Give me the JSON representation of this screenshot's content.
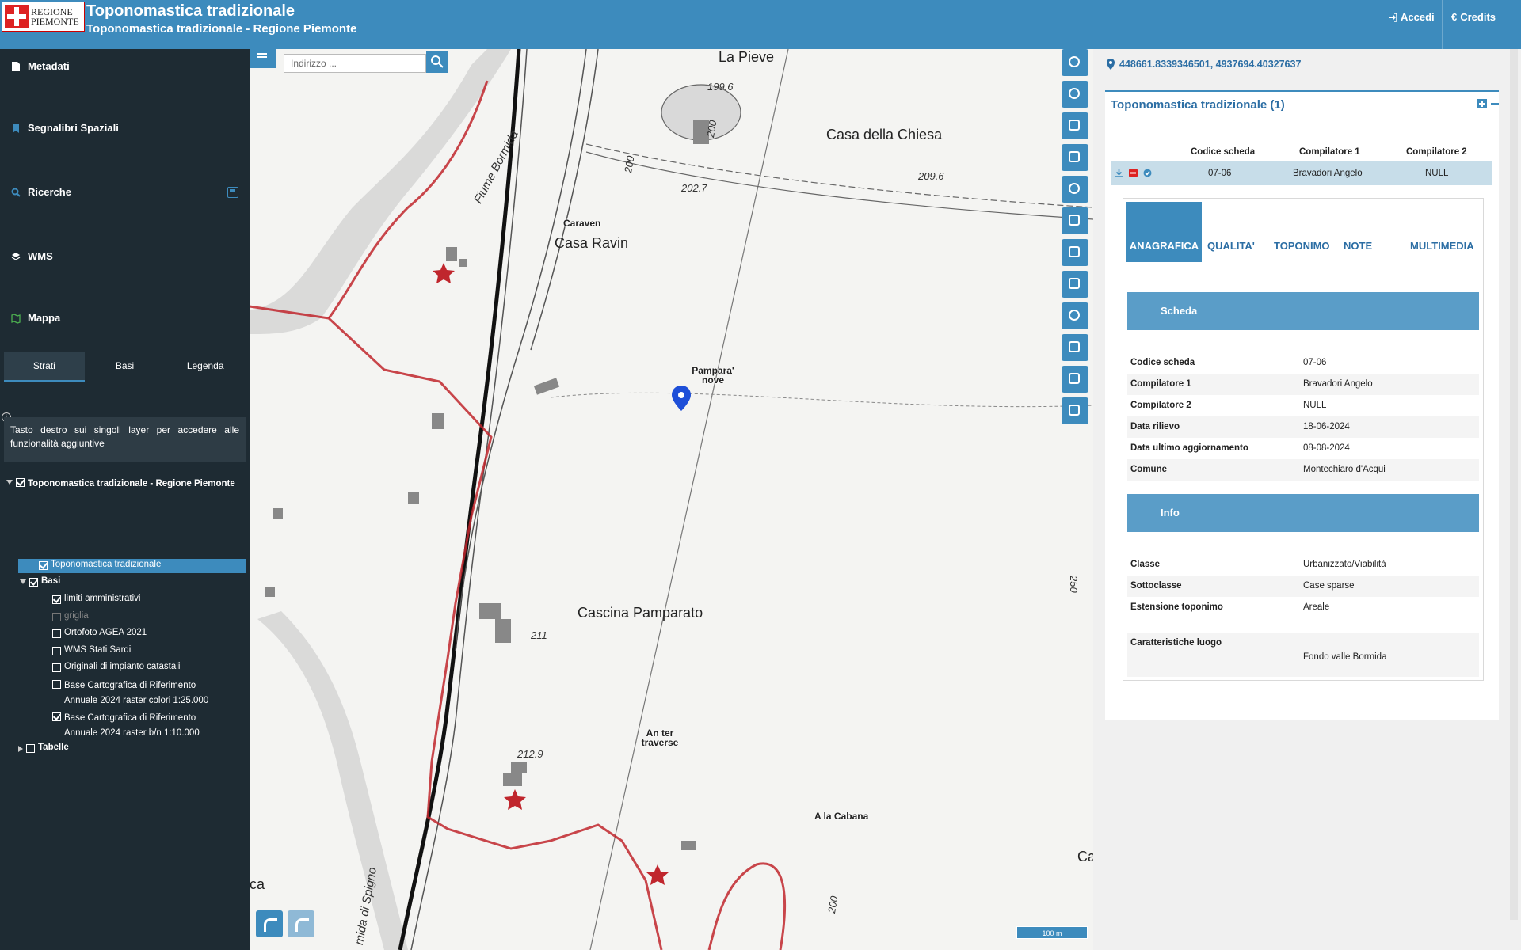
{
  "header": {
    "logo_line1": "REGIONE",
    "logo_line2": "PIEMONTE",
    "title": "Toponomastica tradizionale",
    "subtitle": "Toponomastica tradizionale - Regione Piemonte",
    "login": "Accedi",
    "credits": "Credits"
  },
  "sidebar": {
    "nav": [
      "Metadati",
      "Segnalibri Spaziali",
      "Ricerche",
      "WMS",
      "Mappa"
    ],
    "tabs": [
      "Strati",
      "Basi",
      "Legenda"
    ],
    "info": "Tasto destro sui singoli layer per accedere alle funzionalità aggiuntive",
    "tree": {
      "root": "Toponomastica tradizionale - Regione Piemonte",
      "layer": "Toponomastica tradizionale",
      "basi": "Basi",
      "items": [
        "limiti amministrativi",
        "griglia",
        "Ortofoto AGEA 2021",
        "WMS Stati Sardi",
        "Originali di impianto catastali",
        "Base Cartografica di Riferimento",
        "Annuale 2024 raster colori 1:25.000",
        "Base Cartografica di Riferimento",
        "Annuale 2024 raster b/n 1:10.000"
      ],
      "tabelle": "Tabelle"
    }
  },
  "map": {
    "search_placeholder": "Indirizzo ...",
    "labels": {
      "la_pieve": "La Pieve",
      "casa_chiesa": "Casa della Chiesa",
      "caraven": "Caraven",
      "casa_ravin": "Casa Ravin",
      "pampara": "Pampara'",
      "nove": "nove",
      "cascina": "Cascina Pamparato",
      "an_ter": "An ter",
      "traverse": "traverse",
      "cabana": "A la Cabana",
      "fiume": "Fiume Bormida",
      "spigno": "mida di Spigno",
      "ca": "ca",
      "ca_right": "Ca",
      "n200a": "200",
      "n200b": "200",
      "n200c": "200",
      "n250": "250",
      "n199": "199.6",
      "n202": "202.7",
      "n209": "209.6",
      "n211": "211",
      "n212": "212.9"
    },
    "scale": "100 m"
  },
  "panel": {
    "coords": "448661.8339346501, 4937694.40327637",
    "card_title": "Toponomastica tradizionale (1)",
    "columns": [
      "Codice scheda",
      "Compilatore 1",
      "Compilatore 2"
    ],
    "row": [
      "07-06",
      "Bravadori Angelo",
      "NULL"
    ],
    "tabs": [
      "ANAGRAFICA",
      "QUALITA'",
      "TOPONIMO",
      "NOTE",
      "MULTIMEDIA"
    ],
    "scheda_title": "Scheda",
    "scheda": [
      {
        "k": "Codice scheda",
        "v": "07-06"
      },
      {
        "k": "Compilatore 1",
        "v": "Bravadori Angelo"
      },
      {
        "k": "Compilatore 2",
        "v": "NULL"
      },
      {
        "k": "Data rilievo",
        "v": "18-06-2024"
      },
      {
        "k": "Data ultimo aggiornamento",
        "v": "08-08-2024"
      },
      {
        "k": "Comune",
        "v": "Montechiaro d'Acqui"
      }
    ],
    "info_title": "Info",
    "info": [
      {
        "k": "Classe",
        "v": "Urbanizzato/Viabilità"
      },
      {
        "k": "Sottoclasse",
        "v": "Case sparse"
      },
      {
        "k": "Estensione toponimo",
        "v": "Areale"
      },
      {
        "k": "Caratteristiche luogo",
        "v": "Fondo valle Bormida"
      }
    ]
  },
  "colors": {
    "accent": "#3d8bbd",
    "sidebar": "#1e2b33",
    "boundary": "#c0262d"
  }
}
